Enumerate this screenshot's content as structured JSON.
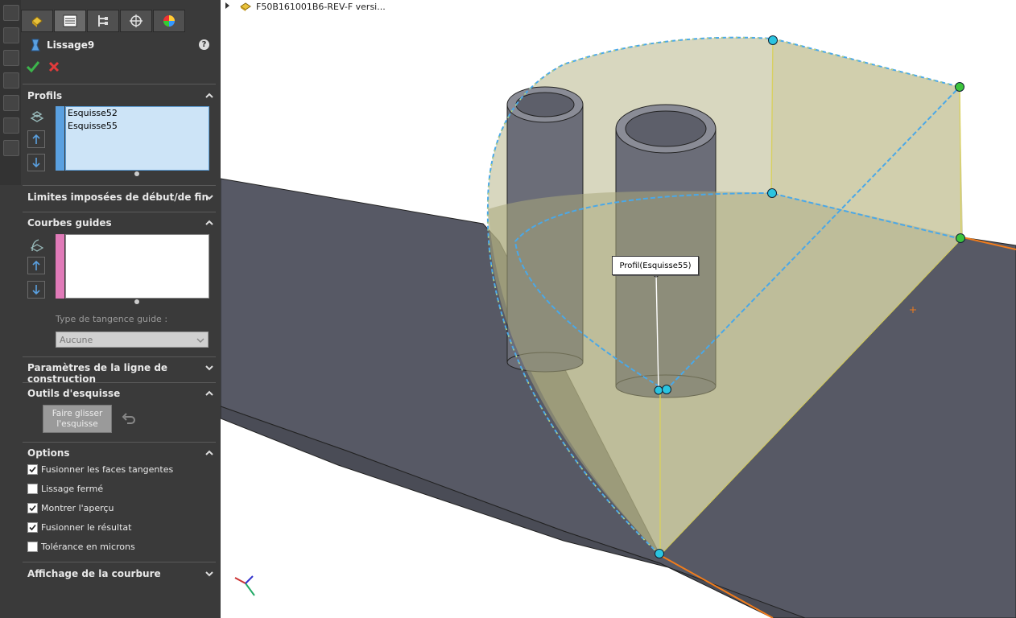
{
  "feature": {
    "title": "Lissage9",
    "help_label": "?"
  },
  "tabs": [
    {
      "name": "feature-manager-icon"
    },
    {
      "name": "property-manager-icon"
    },
    {
      "name": "configuration-manager-icon"
    },
    {
      "name": "dimxpert-manager-icon"
    },
    {
      "name": "display-manager-icon"
    }
  ],
  "sections": {
    "profils": {
      "title": "Profils",
      "items": [
        "Esquisse52",
        "Esquisse55"
      ]
    },
    "limites": {
      "title": "Limites imposées de début/de fin"
    },
    "courbes": {
      "title": "Courbes guides",
      "tangence_label": "Type de tangence guide :",
      "tangence_value": "Aucune"
    },
    "parametres": {
      "title": "Paramètres de la ligne de construction"
    },
    "outils": {
      "title": "Outils d'esquisse",
      "drag_button_line1": "Faire glisser",
      "drag_button_line2": "l'esquisse"
    },
    "options": {
      "title": "Options",
      "items": [
        {
          "label": "Fusionner les faces tangentes",
          "checked": true
        },
        {
          "label": "Lissage fermé",
          "checked": false
        },
        {
          "label": "Montrer l'aperçu",
          "checked": true
        },
        {
          "label": "Fusionner le résultat",
          "checked": true
        },
        {
          "label": "Tolérance en microns",
          "checked": false
        }
      ]
    },
    "affichage": {
      "title": "Affichage de la courbure"
    }
  },
  "viewport": {
    "tree_root": "F50B161001B6-REV-F versi...",
    "tooltip": "Profil(Esquisse55)"
  },
  "colors": {
    "panel_bg": "#3a3a3a",
    "profile_bar": "#5aa0e0",
    "guide_bar": "#e07ab8",
    "accept_green": "#3cb44b",
    "cancel_red": "#e23b3b",
    "loft_fill": "#b8b68a",
    "plate": "#5a5c66"
  }
}
